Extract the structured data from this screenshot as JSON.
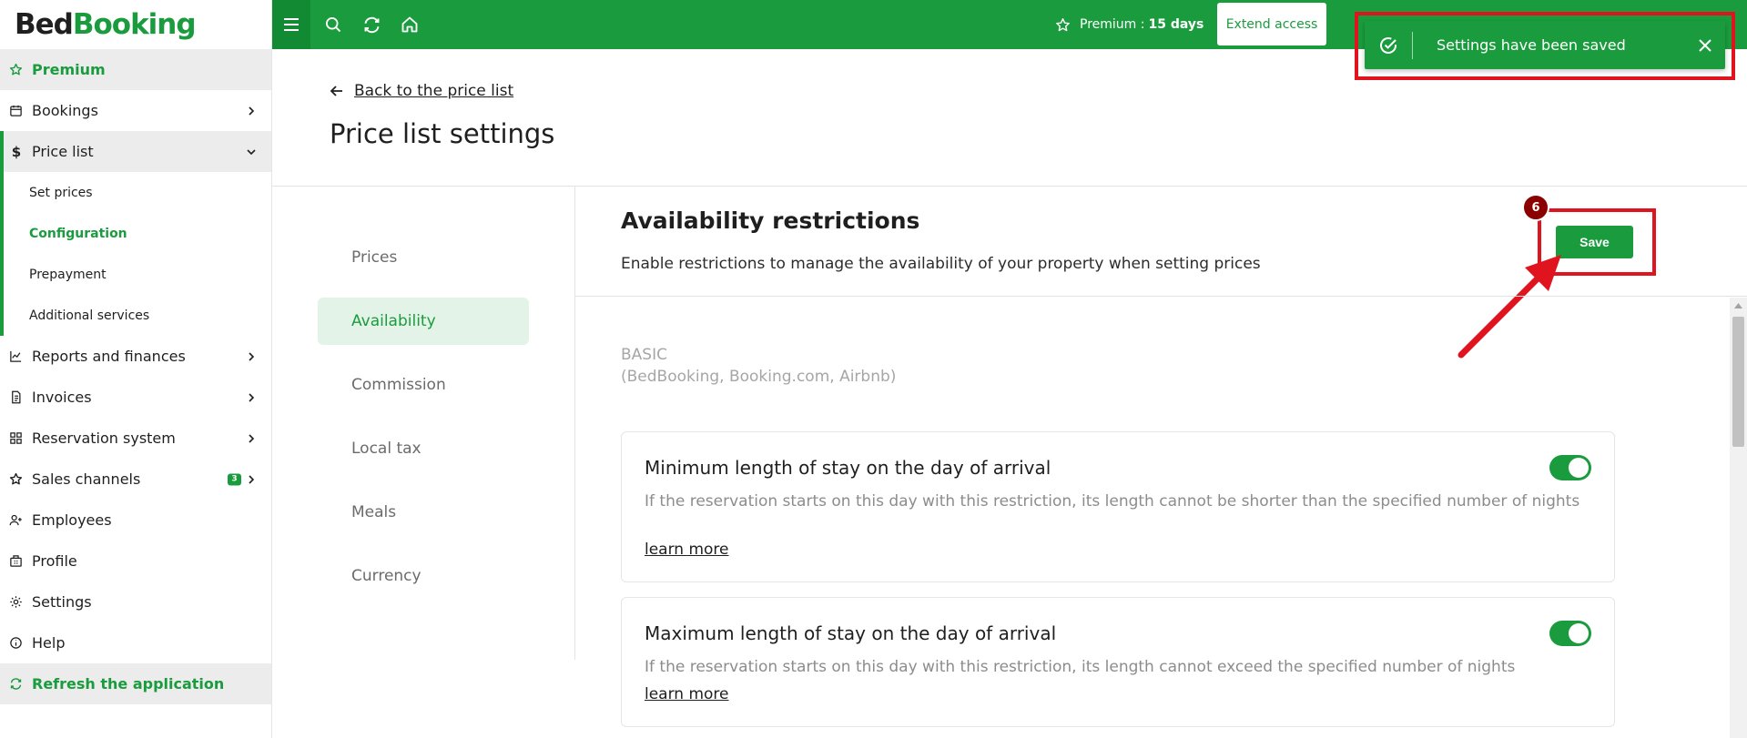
{
  "brand": {
    "part1": "Bed",
    "part2": "Booking"
  },
  "sidebar": {
    "premium": "Premium",
    "bookings": "Bookings",
    "price_list": "Price list",
    "sub": {
      "set_prices": "Set prices",
      "configuration": "Configuration",
      "prepayment": "Prepayment",
      "additional_services": "Additional services"
    },
    "reports": "Reports and finances",
    "invoices": "Invoices",
    "reservation_system": "Reservation system",
    "sales_channels": "Sales channels",
    "sales_channels_badge": "3",
    "employees": "Employees",
    "profile": "Profile",
    "settings": "Settings",
    "help": "Help",
    "refresh": "Refresh the application"
  },
  "topbar": {
    "premium_label": "Premium :",
    "premium_days": "15 days",
    "extend_button": "Extend access"
  },
  "toast": {
    "message": "Settings have been saved"
  },
  "page": {
    "back_link": "Back to the price list",
    "title": "Price list settings"
  },
  "tabs": [
    "Prices",
    "Availability",
    "Commission",
    "Local tax",
    "Meals",
    "Currency"
  ],
  "active_tab": "Availability",
  "section": {
    "title": "Availability restrictions",
    "description": "Enable restrictions to manage the availability of your property when setting prices",
    "save_button": "Save",
    "step_number": "6",
    "group_label_line1": "BASIC",
    "group_label_line2": "(BedBooking, Booking.com, Airbnb)"
  },
  "restrictions": [
    {
      "title": "Minimum length of stay on the day of arrival",
      "description": "If the reservation starts on this day with this restriction, its length cannot be shorter than the specified number of nights",
      "learn_more": "learn more",
      "enabled": true
    },
    {
      "title": "Maximum length of stay on the day of arrival",
      "description": "If the reservation starts on this day with this restriction, its length cannot exceed the specified number of nights",
      "learn_more": "learn more",
      "enabled": true
    }
  ],
  "colors": {
    "brand_green": "#1a9c3e",
    "active_tab_bg": "#e3f3e7",
    "annotation_red": "#e0141e",
    "step_marker": "#8b0000"
  },
  "icons": {
    "menu": "hamburger-icon",
    "search": "search-icon",
    "refresh": "refresh-icon",
    "home": "home-icon",
    "star": "star-icon",
    "check": "check-circle-icon",
    "close": "close-icon",
    "back": "arrow-left-icon"
  }
}
